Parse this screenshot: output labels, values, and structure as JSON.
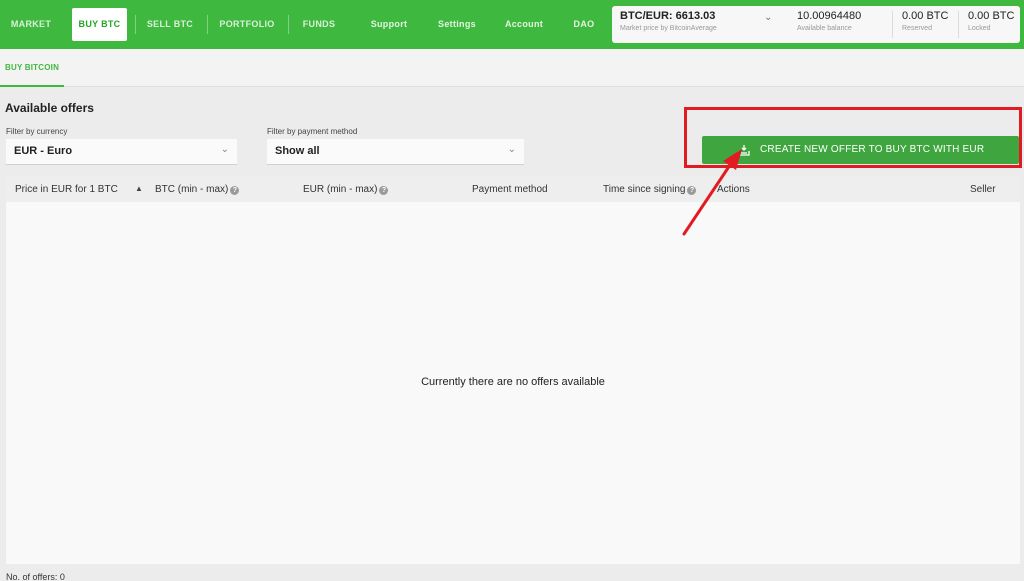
{
  "nav": {
    "market": "MARKET",
    "buy_btc": "BUY BTC",
    "sell_btc": "SELL BTC",
    "portfolio": "PORTFOLIO",
    "funds": "FUNDS",
    "support": "Support",
    "settings": "Settings",
    "account": "Account",
    "dao": "DAO"
  },
  "balance": {
    "price_value": "BTC/EUR: 6613.03",
    "price_label": "Market price by BitcoinAverage",
    "available_value": "10.00964480",
    "available_label": "Available balance",
    "reserved_value": "0.00 BTC",
    "reserved_label": "Reserved",
    "locked_value": "0.00 BTC",
    "locked_label": "Locked"
  },
  "subtabs": {
    "buy_bitcoin": "BUY BITCOIN"
  },
  "offers": {
    "title": "Available offers",
    "currency_filter_label": "Filter by currency",
    "currency_filter_value": "EUR  -  Euro",
    "payment_filter_label": "Filter by payment method",
    "payment_filter_value": "Show all",
    "create_button": "CREATE NEW OFFER TO BUY BTC WITH EUR",
    "empty_message": "Currently there are no offers available",
    "footer": "No. of offers: 0"
  },
  "table": {
    "col_price": "Price in EUR for 1 BTC",
    "col_btc": "BTC (min - max)",
    "col_eur": "EUR (min - max)",
    "col_payment": "Payment method",
    "col_time": "Time since signing",
    "col_actions": "Actions",
    "col_seller": "Seller"
  },
  "icons": {
    "chevron": "chevron-down-icon",
    "help": "help-icon",
    "sort": "sort-up-icon",
    "offer": "create-offer-icon"
  },
  "colors": {
    "brand_green": "#3fb83f",
    "button_green": "#3fa63f",
    "annotation_red": "#e11b22"
  }
}
